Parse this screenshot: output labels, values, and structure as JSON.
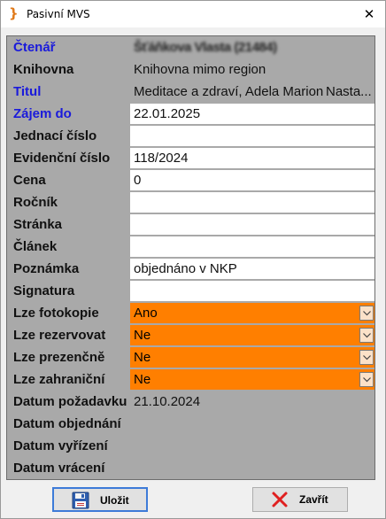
{
  "window": {
    "title": "Pasivní MVS",
    "close_glyph": "✕"
  },
  "form": {
    "rows": [
      {
        "label": "Čtenář",
        "value": "Šťáňkova Vlasta (21484)",
        "style": "gray",
        "label_color": "blue",
        "blurred": true
      },
      {
        "label": "Knihovna",
        "value": "Knihovna mimo region",
        "style": "gray"
      },
      {
        "label": "Titul",
        "value": "Meditace a zdraví, Adela Marion",
        "extra": "Nasta...",
        "style": "gray",
        "label_color": "blue"
      },
      {
        "label": "Zájem do",
        "value": "22.01.2025",
        "style": "white",
        "label_color": "blue"
      },
      {
        "label": "Jednací číslo",
        "value": "",
        "style": "white"
      },
      {
        "label": "Evidenční číslo",
        "value": "118/2024",
        "style": "white"
      },
      {
        "label": "Cena",
        "value": "0",
        "style": "white"
      },
      {
        "label": "Ročník",
        "value": "",
        "style": "white"
      },
      {
        "label": "Stránka",
        "value": "",
        "style": "white"
      },
      {
        "label": "Článek",
        "value": "",
        "style": "white"
      },
      {
        "label": "Poznámka",
        "value": "objednáno v NKP",
        "style": "white"
      },
      {
        "label": "Signatura",
        "value": "",
        "style": "white"
      },
      {
        "label": "Lze fotokopie",
        "value": "Ano",
        "style": "orange",
        "dropdown": true
      },
      {
        "label": "Lze rezervovat",
        "value": "Ne",
        "style": "orange",
        "dropdown": true
      },
      {
        "label": "Lze prezenčně",
        "value": "Ne",
        "style": "orange",
        "dropdown": true
      },
      {
        "label": "Lze zahraniční",
        "value": "Ne",
        "style": "orange",
        "dropdown": true
      },
      {
        "label": "Datum požadavku",
        "value": "21.10.2024",
        "style": "gray"
      },
      {
        "label": "Datum objednání",
        "value": "",
        "style": "gray"
      },
      {
        "label": "Datum vyřízení",
        "value": "",
        "style": "gray"
      },
      {
        "label": "Datum vrácení",
        "value": "",
        "style": "gray"
      }
    ]
  },
  "buttons": {
    "save_label": "Uložit",
    "close_label": "Zavřít"
  },
  "colors": {
    "accent_label": "#1a1adb",
    "orange_field": "#ff7f00",
    "grid_gray": "#a9a9a9",
    "app_icon": "#e07a1a"
  },
  "icons": {
    "app": "app-logo-icon",
    "save": "floppy-disk-icon",
    "close": "red-x-icon",
    "dropdown": "chevron-down-icon"
  }
}
